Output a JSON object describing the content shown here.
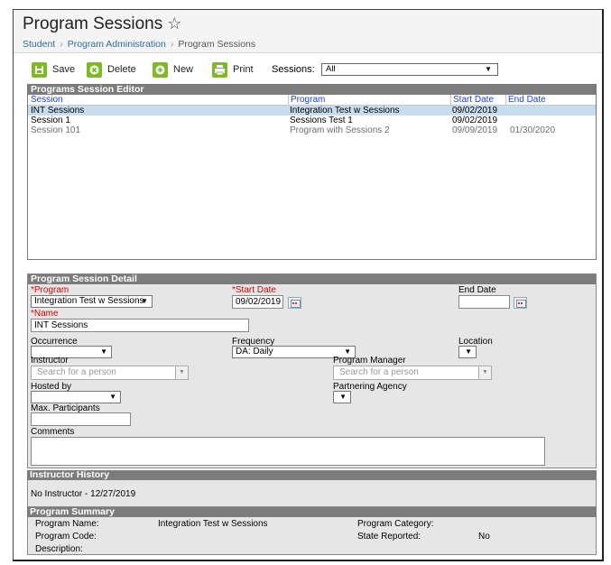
{
  "header": {
    "title": "Program Sessions",
    "breadcrumb": [
      "Student",
      "Program Administration",
      "Program Sessions"
    ]
  },
  "toolbar": {
    "save": "Save",
    "delete": "Delete",
    "new": "New",
    "print": "Print",
    "sessions_label": "Sessions:",
    "sessions_value": "All"
  },
  "editor": {
    "title": "Programs Session Editor",
    "columns": [
      "Session",
      "Program",
      "Start Date",
      "End Date"
    ],
    "rows": [
      {
        "session": "INT Sessions",
        "program": "Integration Test w Sessions",
        "start": "09/02/2019",
        "end": ""
      },
      {
        "session": "Session 1",
        "program": "Sessions Test 1",
        "start": "09/02/2019",
        "end": ""
      },
      {
        "session": "Session 101",
        "program": "Program with Sessions 2",
        "start": "09/09/2019",
        "end": "01/30/2020"
      }
    ]
  },
  "detail": {
    "title": "Program Session Detail",
    "program_label": "*Program",
    "program_value": "Integration Test w Sessions",
    "start_label": "*Start Date",
    "start_value": "09/02/2019",
    "end_label": "End Date",
    "end_value": "",
    "name_label": "*Name",
    "name_value": "INT Sessions",
    "occurrence_label": "Occurrence",
    "occurrence_value": "",
    "frequency_label": "Frequency",
    "frequency_value": "DA: Daily",
    "location_label": "Location",
    "location_value": "",
    "instructor_label": "Instructor",
    "instructor_placeholder": "Search for a person",
    "manager_label": "Program Manager",
    "manager_placeholder": "Search for a person",
    "hosted_label": "Hosted by",
    "hosted_value": "",
    "partner_label": "Partnering Agency",
    "partner_value": "",
    "max_label": "Max. Participants",
    "max_value": "",
    "comments_label": "Comments",
    "comments_value": ""
  },
  "history": {
    "title": "Instructor History",
    "text": "No Instructor - 12/27/2019"
  },
  "summary": {
    "title": "Program Summary",
    "name_label": "Program Name:",
    "name_value": "Integration Test w Sessions",
    "code_label": "Program Code:",
    "code_value": "",
    "desc_label": "Description:",
    "desc_value": "",
    "category_label": "Program Category:",
    "category_value": "",
    "state_label": "State Reported:",
    "state_value": "No"
  },
  "colors": {
    "accent_green": "#7db928",
    "section_gray": "#7c7c7c",
    "selected_row": "#c5ddef",
    "link_blue": "#2d6ca2",
    "required_red": "#e00000"
  }
}
